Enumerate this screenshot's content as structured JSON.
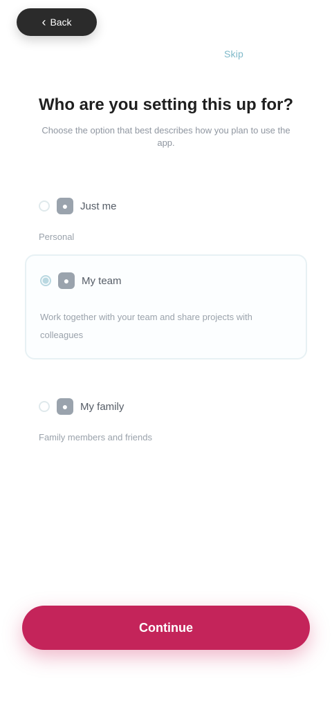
{
  "header": {
    "back_label": "Back",
    "top_link_label": "Skip"
  },
  "page": {
    "title": "Who are you setting this up for?",
    "subtitle": "Choose the option that best describes how you plan to use the app."
  },
  "options": [
    {
      "label": "Just me",
      "description": "Personal",
      "selected": false,
      "icon": "person-icon"
    },
    {
      "label": "My team",
      "description": "Work together with your team and share projects with colleagues",
      "selected": true,
      "icon": "team-icon"
    },
    {
      "label": "My family",
      "description": "Family members and friends",
      "selected": false,
      "icon": "home-icon"
    }
  ],
  "footer": {
    "continue_label": "Continue"
  },
  "colors": {
    "accent": "#c4245a",
    "link": "#7fb9c9"
  }
}
